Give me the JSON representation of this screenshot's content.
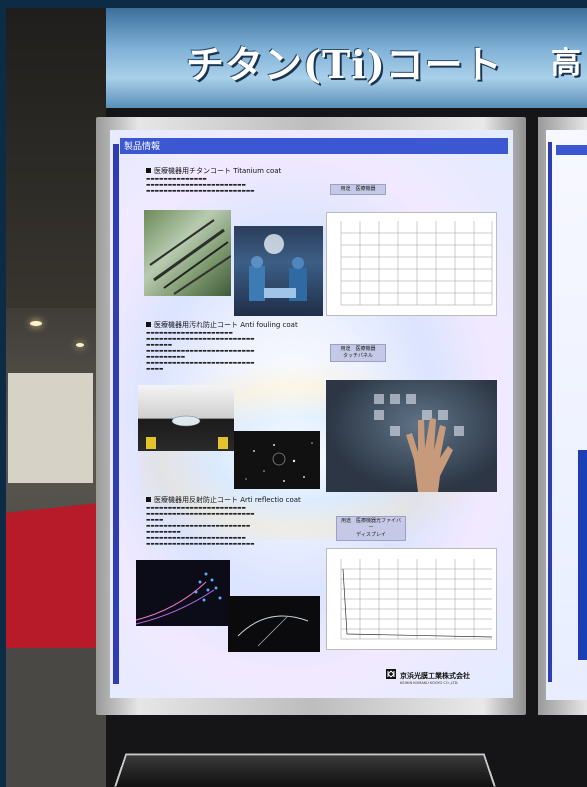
{
  "banner": {
    "title": "チタン(Ti)コート",
    "right_partial": "高"
  },
  "poster": {
    "header": "製品情報",
    "sections": [
      {
        "title": "医療機器用チタンコート",
        "title_en": "Titanium coat",
        "tag": "用途　医療機器"
      },
      {
        "title": "医療機器用汚れ防止コート",
        "title_en": "Anti fouling coat",
        "tag_line1": "用途　医療機器",
        "tag_line2": "タッチパネル"
      },
      {
        "title": "医療機器用反射防止コート",
        "title_en": "Arti reflectio coat",
        "tag_line1": "用途　医療機器光ファイバー",
        "tag_line2": "ディスプレイ"
      }
    ],
    "company_name": "京浜光膜工業株式会社",
    "company_en": "KEIHIN KOMAKU KOGYO CO.,LTD."
  },
  "colors": {
    "poster_accent": "#3b57d1",
    "banner_blue": "#7fb0d6",
    "carpet_red": "#b71b2a"
  }
}
